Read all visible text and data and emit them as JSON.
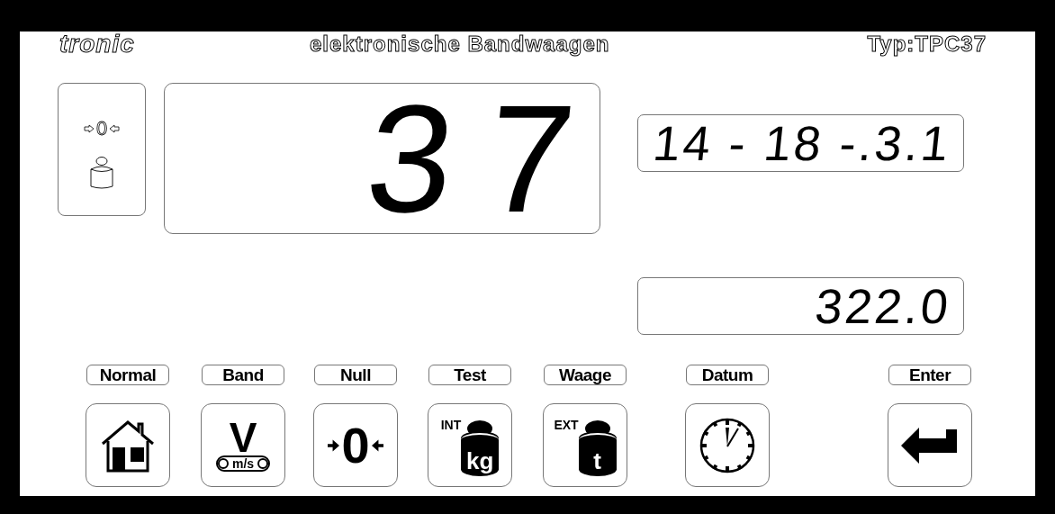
{
  "header": {
    "brand": "tronic",
    "title": "elektronische Bandwaagen",
    "model": "Typ:TPC37"
  },
  "status": {
    "zero_mark": {
      "symbol": "0",
      "on": false
    },
    "weight_mark": {
      "on": false
    }
  },
  "main_display": {
    "value": "37"
  },
  "info_display": {
    "value": "14 - 18 -.3.1"
  },
  "total_display": {
    "value": "322.0"
  },
  "keys": [
    {
      "label": "Normal",
      "kind": "home"
    },
    {
      "label": "Band",
      "kind": "speed",
      "symbol": "V",
      "unit": "m/s"
    },
    {
      "label": "Null",
      "kind": "zero",
      "symbol": "0"
    },
    {
      "label": "Test",
      "kind": "weight",
      "badge": "INT",
      "unit": "kg"
    },
    {
      "label": "Waage",
      "kind": "weight",
      "badge": "EXT",
      "unit": "t"
    },
    {
      "label": "Datum",
      "kind": "clock"
    },
    {
      "label": "Enter",
      "kind": "enter"
    }
  ]
}
